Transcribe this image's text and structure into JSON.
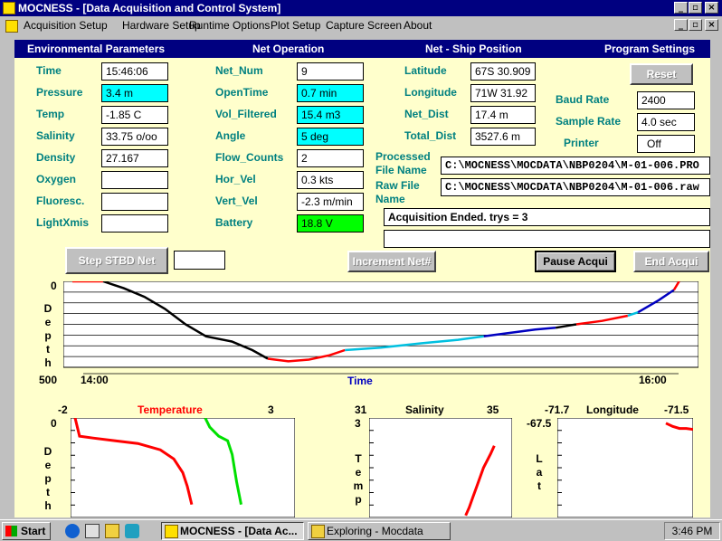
{
  "window": {
    "title": "MOCNESS - [Data Acquisition and Control System]"
  },
  "menu": [
    "Acquisition Setup",
    "Hardware Setup",
    "Runtime Options",
    "Plot Setup",
    "Capture Screen",
    "About"
  ],
  "sections": {
    "environmental": "Environmental Parameters",
    "net_operation": "Net Operation",
    "net_ship": "Net - Ship Position",
    "program_settings": "Program Settings"
  },
  "env": [
    {
      "label": "Time",
      "value": "15:46:06",
      "highlight": "none"
    },
    {
      "label": "Pressure",
      "value": "3.4 m",
      "highlight": "cyan"
    },
    {
      "label": "Temp",
      "value": "-1.85 C",
      "highlight": "none"
    },
    {
      "label": "Salinity",
      "value": "33.75 o/oo",
      "highlight": "none"
    },
    {
      "label": "Density",
      "value": "27.167",
      "highlight": "none"
    },
    {
      "label": "Oxygen",
      "value": "",
      "highlight": "none"
    },
    {
      "label": "Fluoresc.",
      "value": "",
      "highlight": "none"
    },
    {
      "label": "LightXmis",
      "value": "",
      "highlight": "none"
    }
  ],
  "net": [
    {
      "label": "Net_Num",
      "value": "9",
      "highlight": "none"
    },
    {
      "label": "OpenTime",
      "value": "0.7 min",
      "highlight": "cyan"
    },
    {
      "label": "Vol_Filtered",
      "value": "15.4 m3",
      "highlight": "cyan"
    },
    {
      "label": "Angle",
      "value": "5 deg",
      "highlight": "cyan"
    },
    {
      "label": "Flow_Counts",
      "value": "2",
      "highlight": "none"
    },
    {
      "label": "Hor_Vel",
      "value": "0.3 kts",
      "highlight": "none"
    },
    {
      "label": "Vert_Vel",
      "value": "-2.3 m/min",
      "highlight": "none"
    },
    {
      "label": "Battery",
      "value": "18.8 V",
      "highlight": "green"
    }
  ],
  "position": [
    {
      "label": "Latitude",
      "value": "67S 30.909"
    },
    {
      "label": "Longitude",
      "value": "71W 31.92"
    },
    {
      "label": "Net_Dist",
      "value": "17.4 m"
    },
    {
      "label": "Total_Dist",
      "value": "3527.6 m"
    }
  ],
  "settings": {
    "reset_label": "Reset",
    "baud_label": "Baud Rate",
    "baud_value": "2400",
    "sample_label": "Sample Rate",
    "sample_value": "4.0 sec",
    "printer_label": "Printer",
    "printer_value": "Off"
  },
  "files": {
    "processed_label_1": "Processed",
    "processed_label_2": "File Name",
    "processed_value": "C:\\MOCNESS\\MOCDATA\\NBP0204\\M-01-006.PRO",
    "raw_label_1": "Raw File",
    "raw_label_2": "Name",
    "raw_value": "C:\\MOCNESS\\MOCDATA\\NBP0204\\M-01-006.raw"
  },
  "status": {
    "message": "Acquisition Ended. trys = 3",
    "message2": ""
  },
  "buttons": {
    "step_stbd": "Step STBD Net",
    "step_value": "",
    "increment": "Increment Net#",
    "pause": "Pause Acqui",
    "end": "End Acqui"
  },
  "chart_data": [
    {
      "type": "line",
      "title": "",
      "xlabel": "Time",
      "ylabel": "Depth",
      "x_ticks": [
        "14:00",
        "16:00"
      ],
      "y_ticks": [
        "0",
        "500"
      ],
      "xlim": [
        "14:00",
        "16:00"
      ],
      "ylim": [
        0,
        500
      ],
      "grid": true,
      "series": [
        {
          "color": "#ff0000",
          "x": [
            "14:00",
            "14:01",
            "14:03",
            "14:06"
          ],
          "y": [
            0,
            0,
            0,
            0
          ]
        },
        {
          "color": "#000000",
          "x": [
            "14:06",
            "14:10",
            "14:14",
            "14:18",
            "14:22",
            "14:26",
            "14:31",
            "14:35",
            "14:38"
          ],
          "y": [
            0,
            40,
            90,
            160,
            250,
            320,
            350,
            400,
            450
          ]
        },
        {
          "color": "#ff0000",
          "x": [
            "14:38",
            "14:42",
            "14:46",
            "14:50",
            "14:53"
          ],
          "y": [
            450,
            465,
            455,
            430,
            400
          ]
        },
        {
          "color": "#00c0e0",
          "x": [
            "14:53",
            "15:00",
            "15:08",
            "15:15",
            "15:20"
          ],
          "y": [
            400,
            385,
            360,
            340,
            320
          ]
        },
        {
          "color": "#0000c0",
          "x": [
            "15:20",
            "15:25",
            "15:30",
            "15:34"
          ],
          "y": [
            320,
            300,
            280,
            270
          ]
        },
        {
          "color": "#000000",
          "x": [
            "15:34",
            "15:38"
          ],
          "y": [
            270,
            250
          ]
        },
        {
          "color": "#ff0000",
          "x": [
            "15:38",
            "15:43",
            "15:48"
          ],
          "y": [
            250,
            230,
            200
          ]
        },
        {
          "color": "#00c0e0",
          "x": [
            "15:48",
            "15:50"
          ],
          "y": [
            200,
            180
          ]
        },
        {
          "color": "#0000c0",
          "x": [
            "15:50",
            "15:54",
            "15:57"
          ],
          "y": [
            180,
            110,
            50
          ]
        },
        {
          "color": "#ff0000",
          "x": [
            "15:57",
            "15:58"
          ],
          "y": [
            50,
            0
          ]
        }
      ]
    },
    {
      "type": "scatter",
      "title": "Temperature",
      "ylabel": "Depth",
      "xlim": [
        -2,
        3
      ],
      "x_ticks": [
        "-2",
        "3"
      ],
      "y_ticks": [
        "0"
      ],
      "series": [
        {
          "color": "#ff0000",
          "x": [
            -1.9,
            -1.8,
            -1.5,
            -1.0,
            -0.5,
            0.0,
            0.3,
            0.5,
            0.6,
            0.7
          ],
          "y": [
            0,
            20,
            22,
            25,
            28,
            35,
            45,
            60,
            75,
            95
          ]
        },
        {
          "color": "#00e000",
          "x": [
            1.0,
            1.1,
            1.2,
            1.3,
            1.5,
            1.6,
            1.7,
            1.8
          ],
          "y": [
            0,
            10,
            15,
            20,
            25,
            40,
            70,
            95
          ]
        }
      ]
    },
    {
      "type": "scatter",
      "title": "Salinity",
      "ylabel": "Temp",
      "xlim": [
        31,
        35
      ],
      "ylim": [
        3,
        -2
      ],
      "x_ticks": [
        "31",
        "35"
      ],
      "y_ticks": [
        "3"
      ],
      "series": [
        {
          "color": "#ff0000",
          "x": [
            33.7,
            33.8,
            33.9,
            34.0,
            34.2,
            34.4,
            34.5
          ],
          "y": [
            -1.9,
            -1.5,
            -1.0,
            -0.5,
            0.5,
            1.2,
            1.6
          ]
        }
      ]
    },
    {
      "type": "scatter",
      "title": "Longitude",
      "ylabel": "Lat",
      "xlim": [
        -71.7,
        -71.5
      ],
      "x_ticks": [
        "-71.7",
        "-71.5"
      ],
      "y_ticks": [
        "-67.5"
      ],
      "series": [
        {
          "color": "#ff0000",
          "x": [
            -71.54,
            -71.53,
            -71.52,
            -71.51,
            -71.5
          ],
          "y": [
            -67.51,
            -67.513,
            -67.515,
            -67.515,
            -67.516
          ]
        }
      ]
    }
  ],
  "taskbar": {
    "start": "Start",
    "tasks": [
      "MOCNESS - [Data Ac...",
      "Exploring - Mocdata"
    ],
    "clock": "3:46 PM"
  }
}
